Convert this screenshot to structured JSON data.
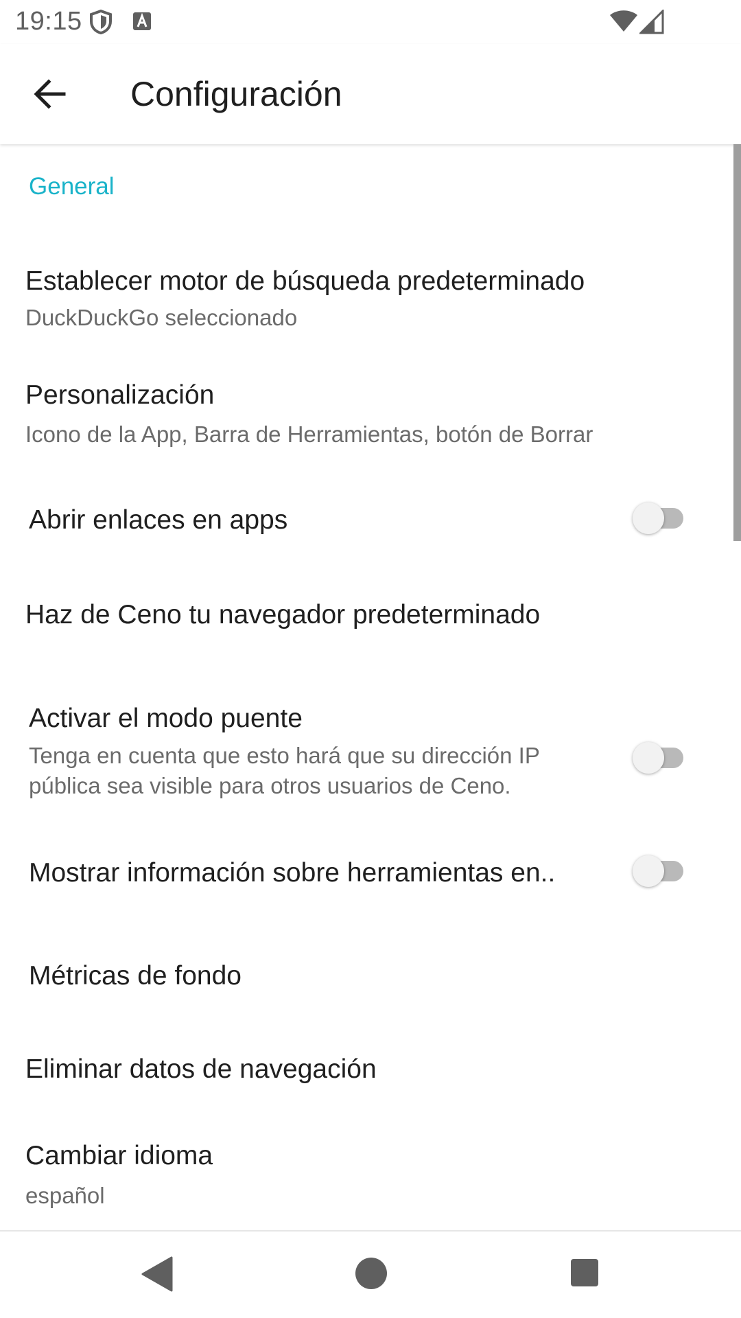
{
  "status_bar": {
    "time": "19:15",
    "icons": [
      "shield-icon",
      "a-notification-icon",
      "wifi-icon",
      "signal-icon"
    ]
  },
  "app_bar": {
    "back_icon": "arrow-back-icon",
    "title": "Configuración"
  },
  "colors": {
    "accent": "#1ab3c9",
    "text_primary": "#1f1f1f",
    "text_secondary": "#6b6b6b"
  },
  "general": {
    "header": "General",
    "items": [
      {
        "title": "Establecer motor de búsqueda predeterminado",
        "summary": "DuckDuckGo seleccionado"
      },
      {
        "title": "Personalización",
        "summary": "Icono de la App, Barra de Herramientas, botón de Borrar"
      },
      {
        "title": "Abrir enlaces en apps",
        "switch_on": false
      },
      {
        "title": "Haz de Ceno tu navegador predeterminado"
      },
      {
        "title": "Activar el modo puente",
        "summary_lines": [
          "Tenga en cuenta que esto hará que su dirección IP",
          "pública sea visible para otros usuarios de Ceno."
        ],
        "switch_on": false
      },
      {
        "title": "Mostrar información sobre herramientas en..",
        "switch_on": false
      },
      {
        "title": "Métricas de fondo"
      },
      {
        "title": "Eliminar datos de navegación"
      },
      {
        "title": "Cambiar idioma",
        "summary": "español"
      }
    ]
  },
  "nav_bar": {
    "icons": [
      "nav-back-icon",
      "nav-home-icon",
      "nav-recents-icon"
    ]
  }
}
